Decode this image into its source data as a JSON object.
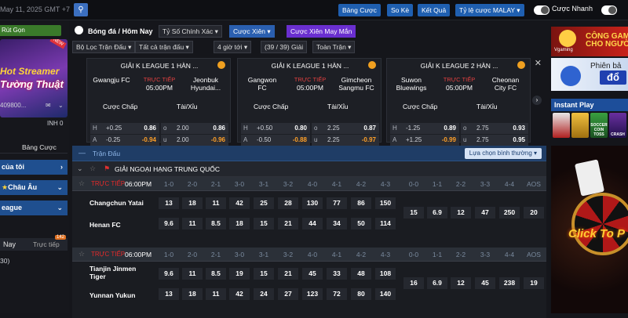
{
  "topbar": {
    "datetime": "May 11, 2025 GMT +7",
    "buttons": [
      "Bảng Cược",
      "So Kè",
      "Kết Quả",
      "Tỷ lệ cược MALAY ▾"
    ],
    "toggle_fast_label": "Cược Nhanh"
  },
  "left": {
    "top_button": "Rút Gọn",
    "banner_line1": "Hot Streamer",
    "banner_line2": "Tường Thuật",
    "banner_badge": "NEW",
    "account": "409800...",
    "balance_label": "INH",
    "balance": "0",
    "tab_bet": "Bảng Cược",
    "nav_items": [
      "của tôi",
      "Châu Âu",
      "eague"
    ],
    "sub_tabs": [
      "Nay",
      "Trực tiếp"
    ],
    "sub_badge": "142",
    "count": "30)"
  },
  "filters": {
    "title": "Bóng đá / Hôm Nay",
    "odds_type": "Tỷ Số Chính Xác ▾",
    "parlay": "Cược Xiên ▾",
    "lucky_parlay": "Cược Xiên May Mắn",
    "match_filter": "Bộ Lọc Trận Đấu ▾",
    "all_matches": "Tất cả trận đấu ▾",
    "hours": "4 giờ tới ▾",
    "leagues": "(39 / 39) Giải",
    "full_match": "Toàn Trận ▾"
  },
  "cards": [
    {
      "league": "GIẢI K LEAGUE 1 HÀN ...",
      "home": "Gwangju FC",
      "away": "Jeonbuk Hyundai...",
      "live": "TRỰC TIẾP",
      "time": "05:00PM",
      "h_label": "Cược Chấp",
      "t_label": "Tài/Xỉu",
      "rows": [
        {
          "s": "H",
          "h": "+0.25",
          "hv": "0.86",
          "t": "o",
          "tl": "2.00",
          "tv": "0.86"
        },
        {
          "s": "A",
          "h": "-0.25",
          "hv": "-0.94",
          "t": "u",
          "tl": "2.00",
          "tv": "-0.96"
        }
      ]
    },
    {
      "league": "GIẢI K LEAGUE 1 HÀN ...",
      "home": "Gangwon FC",
      "away": "Gimcheon Sangmu FC",
      "live": "TRỰC TIẾP",
      "time": "05:00PM",
      "h_label": "Cược Chấp",
      "t_label": "Tài/Xỉu",
      "rows": [
        {
          "s": "H",
          "h": "+0.50",
          "hv": "0.80",
          "t": "o",
          "tl": "2.25",
          "tv": "0.87"
        },
        {
          "s": "A",
          "h": "-0.50",
          "hv": "-0.88",
          "t": "u",
          "tl": "2.25",
          "tv": "-0.97"
        }
      ]
    },
    {
      "league": "GIẢI K LEAGUE 2 HÀN ...",
      "home": "Suwon Bluewings",
      "away": "Cheonan City FC",
      "live": "TRỰC TIẾP",
      "time": "05:00PM",
      "h_label": "Cược Chấp",
      "t_label": "Tài/Xỉu",
      "rows": [
        {
          "s": "H",
          "h": "-1.25",
          "hv": "0.89",
          "t": "o",
          "tl": "2.75",
          "tv": "0.93"
        },
        {
          "s": "A",
          "h": "+1.25",
          "hv": "-0.99",
          "t": "u",
          "tl": "2.75",
          "tv": "0.95"
        }
      ]
    }
  ],
  "table": {
    "header": "Trận Đấu",
    "sort": "Lựa chọn bình thường ▾",
    "league": "GIẢI NGOẠI HẠNG TRUNG QUỐC",
    "score_cols": [
      "1-0",
      "2-0",
      "2-1",
      "3-0",
      "3-1",
      "3-2",
      "4-0",
      "4-1",
      "4-2",
      "4-3",
      "0-0",
      "1-1",
      "2-2",
      "3-3",
      "4-4",
      "AOS"
    ],
    "matches": [
      {
        "live": "TRỰC TIẾP",
        "time": "06:00PM",
        "home": "Changchun Yatai",
        "away": "Henan FC",
        "home_odds": [
          "13",
          "18",
          "11",
          "42",
          "25",
          "28",
          "130",
          "77",
          "86",
          "150"
        ],
        "away_odds": [
          "9.6",
          "11",
          "8.5",
          "18",
          "15",
          "21",
          "44",
          "34",
          "50",
          "114"
        ],
        "draw_odds": [
          "15",
          "6.9",
          "12",
          "47",
          "250",
          "20"
        ]
      },
      {
        "live": "TRỰC TIẾP",
        "time": "06:00PM",
        "home": "Tianjin Jinmen Tiger",
        "away": "Yunnan Yukun",
        "home_odds": [
          "9.6",
          "11",
          "8.5",
          "19",
          "15",
          "21",
          "45",
          "33",
          "48",
          "108"
        ],
        "away_odds": [
          "13",
          "18",
          "11",
          "42",
          "24",
          "27",
          "123",
          "72",
          "80",
          "140"
        ],
        "draw_odds": [
          "16",
          "6.9",
          "12",
          "45",
          "238",
          "19"
        ]
      }
    ]
  },
  "right": {
    "banner1_line1": "CÔNG GAME",
    "banner1_line2": "CHO NGƯỜI",
    "banner1_brand": "Vgaming",
    "banner2_text": "Phiên bả",
    "banner2_logo": "đổ",
    "instant_play": "Instant Play",
    "promo_text": "Click To P",
    "tiles": [
      "",
      "",
      "SOCCER COIN TOSS",
      "CRASH"
    ]
  }
}
